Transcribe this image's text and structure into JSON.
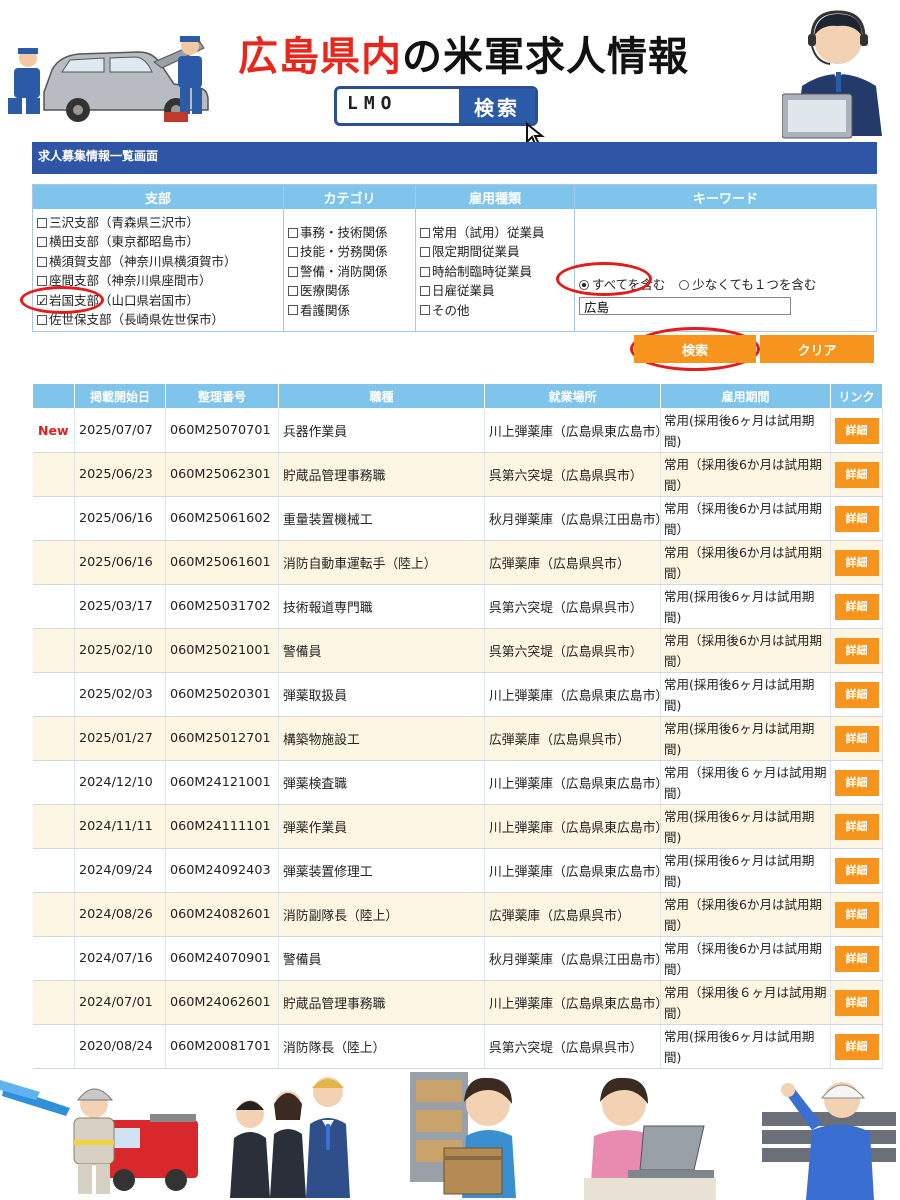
{
  "header": {
    "title_red": "広島県内",
    "title_black": "の米軍求人情報",
    "lmo_text": "LMO",
    "lmo_search": "検索"
  },
  "section_title": "求人募集情報一覧画面",
  "filters": {
    "branch": {
      "header": "支部",
      "options": [
        {
          "label": "三沢支部（青森県三沢市）",
          "checked": false
        },
        {
          "label": "横田支部（東京都昭島市）",
          "checked": false
        },
        {
          "label": "横須賀支部（神奈川県横須賀市）",
          "checked": false
        },
        {
          "label": "座間支部（神奈川県座間市）",
          "checked": false
        },
        {
          "label": "岩国支部（山口県岩国市）",
          "checked": true
        },
        {
          "label": "佐世保支部（長崎県佐世保市）",
          "checked": false
        }
      ]
    },
    "category": {
      "header": "カテゴリ",
      "options": [
        "事務・技術関係",
        "技能・労務関係",
        "警備・消防関係",
        "医療関係",
        "看護関係"
      ]
    },
    "employment": {
      "header": "雇用種類",
      "options": [
        "常用（試用）従業員",
        "限定期間従業員",
        "時給制臨時従業員",
        "日雇従業員",
        "その他"
      ]
    },
    "keyword": {
      "header": "キーワード",
      "radio_all": "すべてを含む",
      "radio_any": "少なくても１つを含む",
      "value": "広島"
    }
  },
  "buttons": {
    "search": "検索",
    "clear": "クリア"
  },
  "table": {
    "headers": [
      "",
      "掲載開始日",
      "整理番号",
      "職種",
      "就業場所",
      "雇用期間",
      "リンク"
    ],
    "detail_label": "詳細",
    "rows": [
      {
        "new": "New",
        "date": "2025/07/07",
        "id": "060M25070701",
        "job": "兵器作業員",
        "place": "川上弾薬庫（広島県東広島市）",
        "period": "常用(採用後6ヶ月は試用期間)"
      },
      {
        "new": "",
        "date": "2025/06/23",
        "id": "060M25062301",
        "job": "貯蔵品管理事務職",
        "place": "呉第六突堤（広島県呉市）",
        "period": "常用（採用後6か月は試用期間）"
      },
      {
        "new": "",
        "date": "2025/06/16",
        "id": "060M25061602",
        "job": "重量装置機械工",
        "place": "秋月弾薬庫（広島県江田島市）",
        "period": "常用（採用後6か月は試用期間）"
      },
      {
        "new": "",
        "date": "2025/06/16",
        "id": "060M25061601",
        "job": "消防自動車運転手（陸上）",
        "place": "広弾薬庫（広島県呉市）",
        "period": "常用（採用後6か月は試用期間）"
      },
      {
        "new": "",
        "date": "2025/03/17",
        "id": "060M25031702",
        "job": "技術報道専門職",
        "place": "呉第六突堤（広島県呉市）",
        "period": "常用(採用後6ヶ月は試用期間)"
      },
      {
        "new": "",
        "date": "2025/02/10",
        "id": "060M25021001",
        "job": "警備員",
        "place": "呉第六突堤（広島県呉市）",
        "period": "常用（採用後6か月は試用期間）"
      },
      {
        "new": "",
        "date": "2025/02/03",
        "id": "060M25020301",
        "job": "弾薬取扱員",
        "place": "川上弾薬庫（広島県東広島市）",
        "period": "常用(採用後6ヶ月は試用期間)"
      },
      {
        "new": "",
        "date": "2025/01/27",
        "id": "060M25012701",
        "job": "構築物施設工",
        "place": "広弾薬庫（広島県呉市）",
        "period": "常用(採用後6ヶ月は試用期間)"
      },
      {
        "new": "",
        "date": "2024/12/10",
        "id": "060M24121001",
        "job": "弾薬検査職",
        "place": "川上弾薬庫（広島県東広島市）",
        "period": "常用（採用後６ヶ月は試用期間）"
      },
      {
        "new": "",
        "date": "2024/11/11",
        "id": "060M24111101",
        "job": "弾薬作業員",
        "place": "川上弾薬庫（広島県東広島市）",
        "period": "常用(採用後6ヶ月は試用期間)"
      },
      {
        "new": "",
        "date": "2024/09/24",
        "id": "060M24092403",
        "job": "弾薬装置修理工",
        "place": "川上弾薬庫（広島県東広島市）",
        "period": "常用(採用後6ヶ月は試用期間)"
      },
      {
        "new": "",
        "date": "2024/08/26",
        "id": "060M24082601",
        "job": "消防副隊長（陸上）",
        "place": "広弾薬庫（広島県呉市）",
        "period": "常用（採用後6か月は試用期間）"
      },
      {
        "new": "",
        "date": "2024/07/16",
        "id": "060M24070901",
        "job": "警備員",
        "place": "秋月弾薬庫（広島県江田島市）",
        "period": "常用（採用後6か月は試用期間）"
      },
      {
        "new": "",
        "date": "2024/07/01",
        "id": "060M24062601",
        "job": "貯蔵品管理事務職",
        "place": "川上弾薬庫（広島県東広島市）",
        "period": "常用（採用後６ヶ月は試用期間）"
      },
      {
        "new": "",
        "date": "2020/08/24",
        "id": "060M20081701",
        "job": "消防隊長（陸上）",
        "place": "呉第六突堤（広島県呉市）",
        "period": "常用(採用後6ヶ月は試用期間)"
      }
    ]
  },
  "colors": {
    "accent_blue": "#2f55a6",
    "header_cyan": "#7fc4ea",
    "button_orange": "#f7941d",
    "highlight_red": "#e21b1b",
    "row_alt": "#fdf6e3"
  }
}
